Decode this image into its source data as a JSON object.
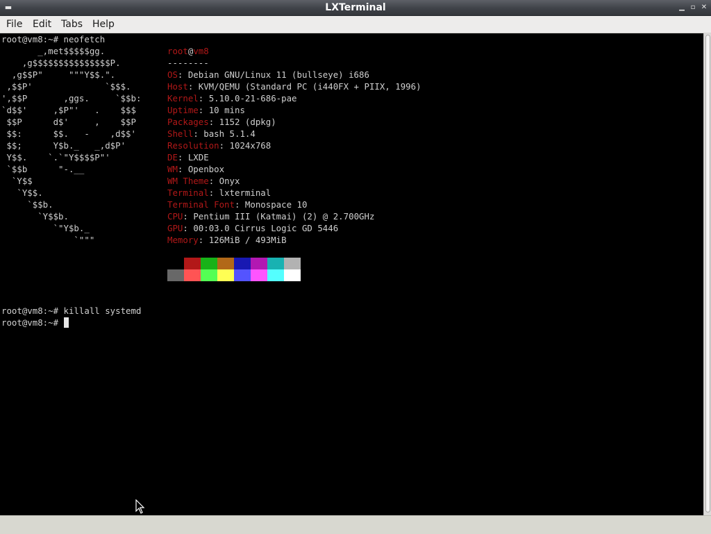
{
  "window": {
    "title": "LXTerminal"
  },
  "menu": [
    "File",
    "Edit",
    "Tabs",
    "Help"
  ],
  "terminal": {
    "cmd1": "root@vm8:~# neofetch",
    "header_user": "root",
    "header_at": "@",
    "header_host": "vm8",
    "header_sep": "--------",
    "info": [
      {
        "key": "OS",
        "value": "Debian GNU/Linux 11 (bullseye) i686"
      },
      {
        "key": "Host",
        "value": "KVM/QEMU (Standard PC (i440FX + PIIX, 1996)"
      },
      {
        "key": "Kernel",
        "value": "5.10.0-21-686-pae"
      },
      {
        "key": "Uptime",
        "value": "10 mins"
      },
      {
        "key": "Packages",
        "value": "1152 (dpkg)"
      },
      {
        "key": "Shell",
        "value": "bash 5.1.4"
      },
      {
        "key": "Resolution",
        "value": "1024x768"
      },
      {
        "key": "DE",
        "value": "LXDE"
      },
      {
        "key": "WM",
        "value": "Openbox"
      },
      {
        "key": "WM Theme",
        "value": "Onyx"
      },
      {
        "key": "Terminal",
        "value": "lxterminal"
      },
      {
        "key": "Terminal Font",
        "value": "Monospace 10"
      },
      {
        "key": "CPU",
        "value": "Pentium III (Katmai) (2) @ 2.700GHz"
      },
      {
        "key": "GPU",
        "value": "00:03.0 Cirrus Logic GD 5446"
      },
      {
        "key": "Memory",
        "value": "126MiB / 493MiB"
      }
    ],
    "logo": [
      [
        "       _,met$$$$$gg.",
        ""
      ],
      [
        "    ,g$$$$$$$$$$$$$$$P.",
        ""
      ],
      [
        "  ,g$$P\"     \"\"\"Y$$.\".",
        ""
      ],
      [
        " ,$$P'              `$$$.",
        ""
      ],
      [
        "',$$P       ,ggs.     `$$b:",
        ""
      ],
      [
        "`d$$'     ,$P\"'   .    $$$",
        ""
      ],
      [
        " $$P      d$'     ,    $$P",
        ""
      ],
      [
        " $$:      $$.   -    ,d$$'",
        ""
      ],
      [
        " $$;      Y$b._   _,d$P'",
        ""
      ],
      [
        " Y$$.    `.`\"Y$$$$P\"'",
        ""
      ],
      [
        " `$$b      \"-.__",
        ""
      ],
      [
        "  `Y$$",
        ""
      ],
      [
        "   `Y$$.",
        ""
      ],
      [
        "     `$$b.",
        ""
      ],
      [
        "       `Y$$b.",
        ""
      ],
      [
        "          `\"Y$b._",
        ""
      ],
      [
        "              `\"\"\"",
        ""
      ]
    ],
    "palette_top": [
      "#000000",
      "#b21818",
      "#18b218",
      "#b26818",
      "#1818b2",
      "#b218b2",
      "#18b2b2",
      "#b2b2b2"
    ],
    "palette_bottom": [
      "#686868",
      "#ff5454",
      "#54ff54",
      "#ffff54",
      "#5454ff",
      "#ff54ff",
      "#54ffff",
      "#ffffff"
    ],
    "cmd2": "root@vm8:~# killall systemd",
    "prompt": "root@vm8:~# "
  },
  "colors": {
    "accent_red": "#b21818",
    "text": "#d0d0d0",
    "background": "#000000"
  }
}
